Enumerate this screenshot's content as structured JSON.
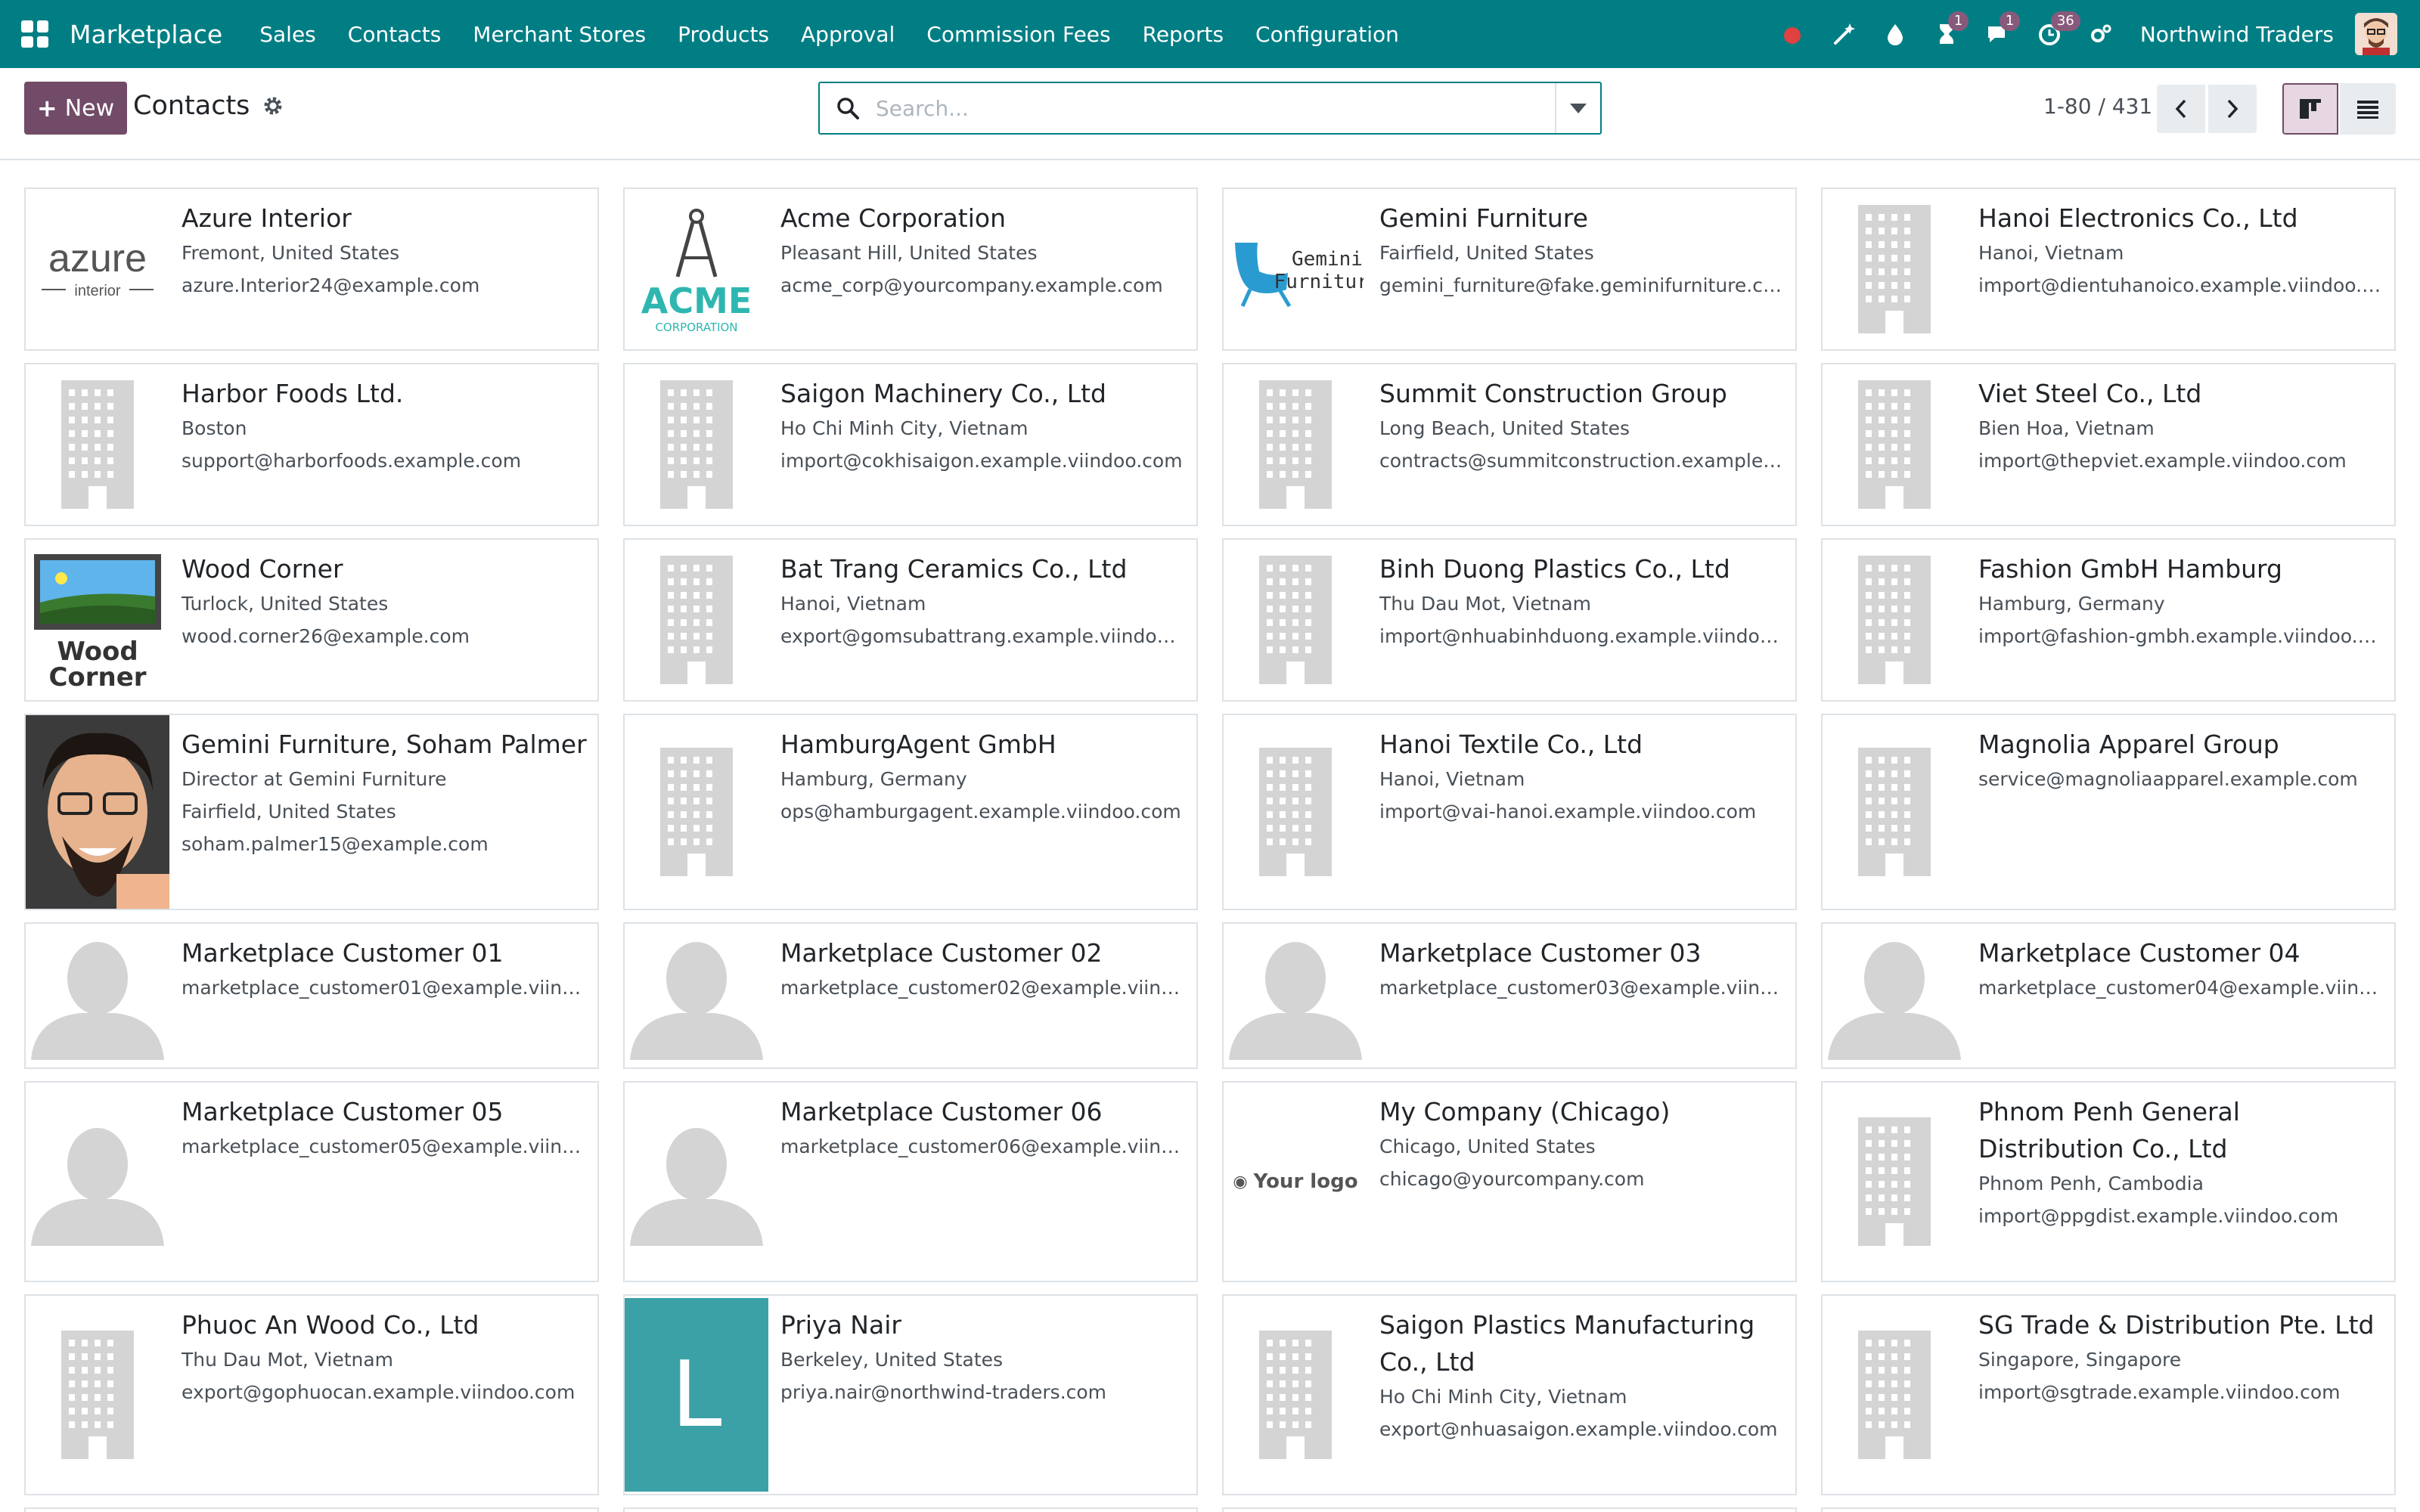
{
  "navbar": {
    "brand": "Marketplace",
    "menu": [
      "Sales",
      "Contacts",
      "Merchant Stores",
      "Products",
      "Approval",
      "Commission Fees",
      "Reports",
      "Configuration"
    ],
    "company": "Northwind Traders",
    "badges": {
      "activities": "1",
      "messages": "1",
      "updates": "36"
    },
    "colors": {
      "bar": "#017e84",
      "badge": "#875a7b",
      "status_dot": "#e04141"
    }
  },
  "control": {
    "new_label": "New",
    "breadcrumb": "Contacts",
    "search_placeholder": "Search...",
    "pager": "1-80 / 431",
    "accent": "#714b67"
  },
  "cards": [
    {
      "name": "Azure Interior",
      "lines": [
        "Fremont, United States",
        "azure.Interior24@example.com"
      ],
      "image": "azure-logo"
    },
    {
      "name": "Acme Corporation",
      "lines": [
        "Pleasant Hill, United States",
        "acme_corp@yourcompany.example.com"
      ],
      "image": "acme-logo"
    },
    {
      "name": "Gemini Furniture",
      "lines": [
        "Fairfield, United States",
        "gemini_furniture@fake.geminifurniture.com"
      ],
      "image": "gemini-logo"
    },
    {
      "name": "Hanoi Electronics Co., Ltd",
      "lines": [
        "Hanoi, Vietnam",
        "import@dientuhanoico.example.viindoo.com"
      ],
      "image": "building"
    },
    {
      "name": "Harbor Foods Ltd.",
      "lines": [
        "Boston",
        "support@harborfoods.example.com"
      ],
      "image": "building"
    },
    {
      "name": "Saigon Machinery Co., Ltd",
      "lines": [
        "Ho Chi Minh City, Vietnam",
        "import@cokhisaigon.example.viindoo.com"
      ],
      "image": "building"
    },
    {
      "name": "Summit Construction Group",
      "lines": [
        "Long Beach, United States",
        "contracts@summitconstruction.example.com"
      ],
      "image": "building"
    },
    {
      "name": "Viet Steel Co., Ltd",
      "lines": [
        "Bien Hoa, Vietnam",
        "import@thepviet.example.viindoo.com"
      ],
      "image": "building"
    },
    {
      "name": "Wood Corner",
      "lines": [
        "Turlock, United States",
        "wood.corner26@example.com"
      ],
      "image": "woodcorner-logo"
    },
    {
      "name": "Bat Trang Ceramics Co., Ltd",
      "lines": [
        "Hanoi, Vietnam",
        "export@gomsubattrang.example.viindoo.com"
      ],
      "image": "building"
    },
    {
      "name": "Binh Duong Plastics Co., Ltd",
      "lines": [
        "Thu Dau Mot, Vietnam",
        "import@nhuabinhduong.example.viindoo.com"
      ],
      "image": "building"
    },
    {
      "name": "Fashion GmbH Hamburg",
      "lines": [
        "Hamburg, Germany",
        "import@fashion-gmbh.example.viindoo.com"
      ],
      "image": "building"
    },
    {
      "name": "Gemini Furniture, Soham Palmer",
      "lines": [
        "Director at Gemini Furniture",
        "Fairfield, United States",
        "soham.palmer15@example.com"
      ],
      "image": "photo"
    },
    {
      "name": "HamburgAgent GmbH",
      "lines": [
        "Hamburg, Germany",
        "ops@hamburgagent.example.viindoo.com"
      ],
      "image": "building"
    },
    {
      "name": "Hanoi Textile Co., Ltd",
      "lines": [
        "Hanoi, Vietnam",
        "import@vai-hanoi.example.viindoo.com"
      ],
      "image": "building"
    },
    {
      "name": "Magnolia Apparel Group",
      "lines": [
        "service@magnoliaapparel.example.com"
      ],
      "image": "building"
    },
    {
      "name": "Marketplace Customer 01",
      "lines": [
        "marketplace_customer01@example.viindoo.c..."
      ],
      "image": "person"
    },
    {
      "name": "Marketplace Customer 02",
      "lines": [
        "marketplace_customer02@example.viindoo.c..."
      ],
      "image": "person"
    },
    {
      "name": "Marketplace Customer 03",
      "lines": [
        "marketplace_customer03@example.viindoo.c..."
      ],
      "image": "person"
    },
    {
      "name": "Marketplace Customer 04",
      "lines": [
        "marketplace_customer04@example.viindoo.c..."
      ],
      "image": "person"
    },
    {
      "name": "Marketplace Customer 05",
      "lines": [
        "marketplace_customer05@example.viindoo.c..."
      ],
      "image": "person"
    },
    {
      "name": "Marketplace Customer 06",
      "lines": [
        "marketplace_customer06@example.viindoo.c..."
      ],
      "image": "person"
    },
    {
      "name": "My Company (Chicago)",
      "lines": [
        "Chicago, United States",
        "chicago@yourcompany.com"
      ],
      "image": "yourlogo",
      "logo_text": "Your logo"
    },
    {
      "name": "Phnom Penh General Distribution Co., Ltd",
      "lines": [
        "Phnom Penh, Cambodia",
        "import@ppgdist.example.viindoo.com"
      ],
      "image": "building"
    },
    {
      "name": "Phuoc An Wood Co., Ltd",
      "lines": [
        "Thu Dau Mot, Vietnam",
        "export@gophuocan.example.viindoo.com"
      ],
      "image": "building"
    },
    {
      "name": "Priya Nair",
      "lines": [
        "Berkeley, United States",
        "priya.nair@northwind-traders.com"
      ],
      "image": "letter",
      "letter": "L",
      "letter_color": "#3ba1a6"
    },
    {
      "name": "Saigon Plastics Manufacturing Co., Ltd",
      "lines": [
        "Ho Chi Minh City, Vietnam",
        "export@nhuasaigon.example.viindoo.com"
      ],
      "image": "building"
    },
    {
      "name": "SG Trade & Distribution Pte. Ltd",
      "lines": [
        "Singapore, Singapore",
        "import@sgtrade.example.viindoo.com"
      ],
      "image": "building"
    }
  ]
}
